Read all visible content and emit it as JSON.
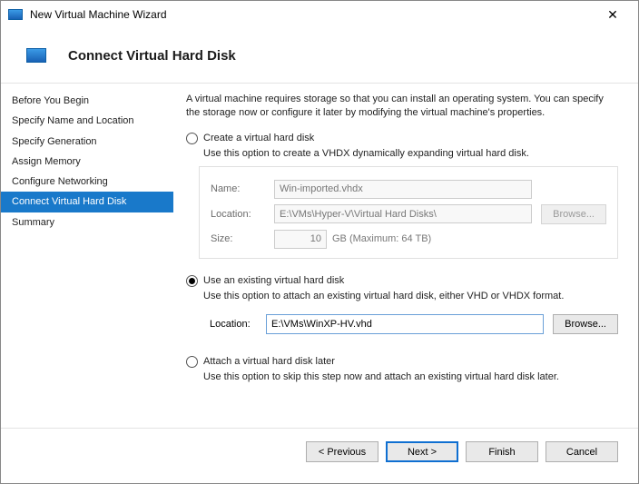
{
  "window": {
    "title": "New Virtual Machine Wizard"
  },
  "header": {
    "title": "Connect Virtual Hard Disk"
  },
  "sidebar": {
    "items": [
      {
        "label": "Before You Begin"
      },
      {
        "label": "Specify Name and Location"
      },
      {
        "label": "Specify Generation"
      },
      {
        "label": "Assign Memory"
      },
      {
        "label": "Configure Networking"
      },
      {
        "label": "Connect Virtual Hard Disk"
      },
      {
        "label": "Summary"
      }
    ]
  },
  "main": {
    "intro": "A virtual machine requires storage so that you can install an operating system. You can specify the storage now or configure it later by modifying the virtual machine's properties.",
    "opt_create": {
      "label": "Create a virtual hard disk",
      "desc": "Use this option to create a VHDX dynamically expanding virtual hard disk.",
      "name_lbl": "Name:",
      "name_val": "Win-imported.vhdx",
      "loc_lbl": "Location:",
      "loc_val": "E:\\VMs\\Hyper-V\\Virtual Hard Disks\\",
      "browse": "Browse...",
      "size_lbl": "Size:",
      "size_val": "10",
      "size_unit": "GB (Maximum: 64 TB)"
    },
    "opt_existing": {
      "label": "Use an existing virtual hard disk",
      "desc": "Use this option to attach an existing virtual hard disk, either VHD or VHDX format.",
      "loc_lbl": "Location:",
      "loc_val": "E:\\VMs\\WinXP-HV.vhd",
      "browse": "Browse..."
    },
    "opt_later": {
      "label": "Attach a virtual hard disk later",
      "desc": "Use this option to skip this step now and attach an existing virtual hard disk later."
    }
  },
  "footer": {
    "previous": "< Previous",
    "next": "Next >",
    "finish": "Finish",
    "cancel": "Cancel"
  }
}
